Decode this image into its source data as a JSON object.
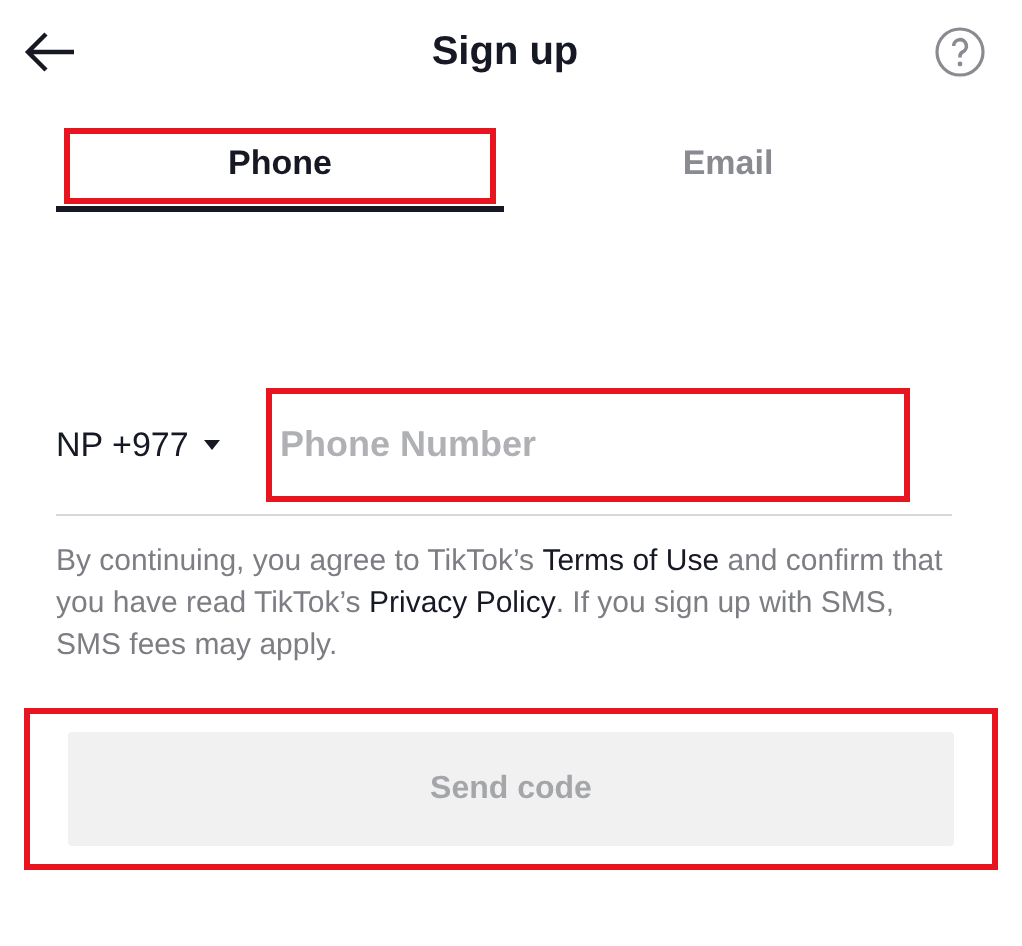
{
  "header": {
    "title": "Sign up"
  },
  "tabs": [
    {
      "label": "Phone",
      "selected": true,
      "highlighted": true
    },
    {
      "label": "Email",
      "selected": false,
      "highlighted": false
    }
  ],
  "phone": {
    "country_code": "NP +977",
    "placeholder": "Phone Number",
    "highlighted": true
  },
  "consent": [
    {
      "kind": "text",
      "text": "By continuing, you agree to TikTok’s"
    },
    {
      "kind": "link",
      "text": "Terms of Use"
    },
    {
      "kind": "text",
      "text": "and confirm that you have read TikTok’s"
    },
    {
      "kind": "link",
      "text": "Privacy Policy"
    },
    {
      "kind": "text",
      "text": ". If you sign up with SMS, SMS fees may apply."
    }
  ],
  "send_button": {
    "label": "Send code",
    "disabled": true,
    "highlighted": true
  }
}
